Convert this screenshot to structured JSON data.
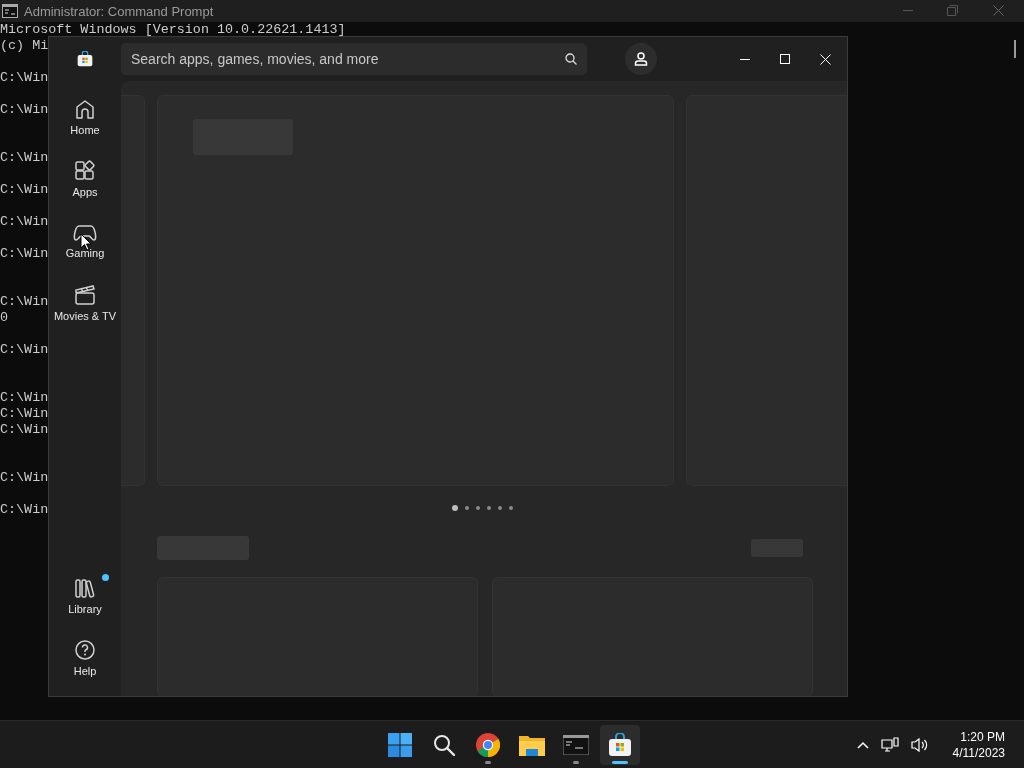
{
  "console_window": {
    "title": "Administrator: Command Prompt",
    "lines": [
      "Microsoft Windows [Version 10.0.22621.1413]",
      "(c) Mi",
      "C:\\Win",
      "C:\\Win",
      "C:\\Win",
      "C:\\Win",
      "C:\\Win",
      "C:\\Win",
      "C:\\Win",
      "0",
      "C:\\Win",
      "C:\\Win",
      "C:\\Win",
      "C:\\Win",
      "C:\\Win",
      "C:\\Win"
    ]
  },
  "store_window": {
    "search": {
      "placeholder": "Search apps, games, movies, and more"
    },
    "nav_items": [
      {
        "label": "Home",
        "kind": "home",
        "notification": false
      },
      {
        "label": "Apps",
        "kind": "apps",
        "notification": false
      },
      {
        "label": "Gaming",
        "kind": "gaming",
        "notification": false
      },
      {
        "label": "Movies & TV",
        "kind": "movies",
        "notification": false
      }
    ],
    "nav_footer_items": [
      {
        "label": "Library",
        "kind": "library",
        "notification": true
      },
      {
        "label": "Help",
        "kind": "help",
        "notification": false
      }
    ],
    "carousel_dots": [
      {
        "selected": true
      },
      {
        "selected": false
      },
      {
        "selected": false
      },
      {
        "selected": false
      },
      {
        "selected": false
      },
      {
        "selected": false
      }
    ]
  },
  "taskbar": {
    "apps": [
      {
        "kind": "start",
        "running": false,
        "active": false
      },
      {
        "kind": "search",
        "running": false,
        "active": false
      },
      {
        "kind": "browser",
        "running": true,
        "active": false
      },
      {
        "kind": "files",
        "running": false,
        "active": false
      },
      {
        "kind": "terminal",
        "running": true,
        "active": false
      },
      {
        "kind": "store",
        "running": true,
        "active": true
      }
    ],
    "time": "1:20 PM",
    "date": "4/11/2023"
  }
}
